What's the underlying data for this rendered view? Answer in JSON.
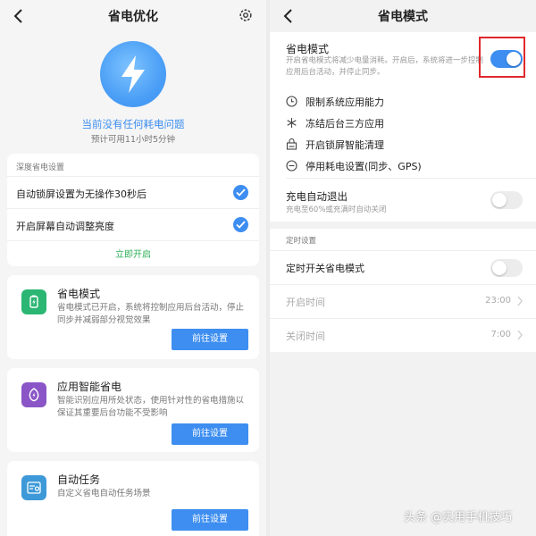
{
  "left": {
    "title": "省电优化",
    "status": "当前没有任何耗电问题",
    "estimate": "预计可用11小时5分钟",
    "deep": {
      "section_title": "深度省电设置",
      "items": [
        {
          "label": "自动锁屏设置为无操作30秒后",
          "checked": true
        },
        {
          "label": "开启屏幕自动调整亮度",
          "checked": true
        }
      ],
      "enable_now": "立即开启"
    },
    "features": [
      {
        "title": "省电模式",
        "desc": "省电模式已开启，系统将控制应用后台活动，停止同步并减弱部分视觉效果",
        "button": "前往设置",
        "icon": "battery-icon",
        "color": "#2bb673"
      },
      {
        "title": "应用智能省电",
        "desc": "智能识别应用所处状态，使用针对性的省电措施以保证其重要后台功能不受影响",
        "button": "前往设置",
        "icon": "leaf-bolt-icon",
        "color": "#8a55c6"
      },
      {
        "title": "自动任务",
        "desc": "自定义省电自动任务场景",
        "button": "前往设置",
        "icon": "task-toggle-icon",
        "color": "#3d99d8"
      }
    ]
  },
  "right": {
    "title": "省电模式",
    "mode": {
      "title": "省电模式",
      "desc": "开启省电模式将减少电量消耗。开启后，系统将进一步控制应用后台活动，并停止同步。",
      "enabled": true
    },
    "bullets": [
      {
        "label": "限制系统应用能力",
        "icon": "clock-icon"
      },
      {
        "label": "冻结后台三方应用",
        "icon": "snowflake-icon"
      },
      {
        "label": "开启锁屏智能清理",
        "icon": "lock-clean-icon"
      },
      {
        "label": "停用耗电设置(同步、GPS)",
        "icon": "minus-circle-icon"
      }
    ],
    "auto_exit": {
      "title": "充电自动退出",
      "desc": "充电至60%或充满时自动关闭",
      "enabled": false
    },
    "timer": {
      "section_label": "定时设置",
      "toggle_label": "定时开关省电模式",
      "enabled": false,
      "start_label": "开启时间",
      "start_value": "23:00",
      "end_label": "关闭时间",
      "end_value": "7:00"
    }
  },
  "watermark": "头条 @实用手机技巧",
  "colors": {
    "accent": "#3d8ef0",
    "success": "#2fb05a",
    "highlight": "#e0282c"
  }
}
